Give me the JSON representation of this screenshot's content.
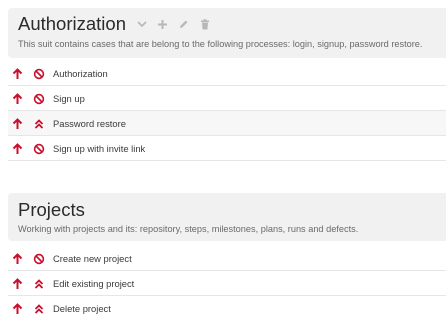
{
  "suites": [
    {
      "title": "Authorization",
      "description": "This suit contains cases that are belong to the following processes: login, signup, password restore.",
      "cases": [
        {
          "name": "Authorization",
          "priority_icon": "arrow-up-icon",
          "severity_icon": "blocker-icon"
        },
        {
          "name": "Sign up",
          "priority_icon": "arrow-up-icon",
          "severity_icon": "blocker-icon"
        },
        {
          "name": "Password restore",
          "priority_icon": "arrow-up-icon",
          "severity_icon": "critical-icon"
        },
        {
          "name": "Sign up with invite link",
          "priority_icon": "arrow-up-icon",
          "severity_icon": "blocker-icon"
        }
      ]
    },
    {
      "title": "Projects",
      "description": "Working with projects and its: repository, steps, milestones, plans, runs and defects.",
      "cases": [
        {
          "name": "Create new project",
          "priority_icon": "arrow-up-icon",
          "severity_icon": "blocker-icon"
        },
        {
          "name": "Edit existing project",
          "priority_icon": "arrow-up-icon",
          "severity_icon": "critical-icon"
        },
        {
          "name": "Delete project",
          "priority_icon": "arrow-up-icon",
          "severity_icon": "critical-icon"
        }
      ]
    }
  ],
  "colors": {
    "icon_red": "#c8102e",
    "tool_gray": "#b8b8b8",
    "header_bg": "#f1f1f1"
  }
}
